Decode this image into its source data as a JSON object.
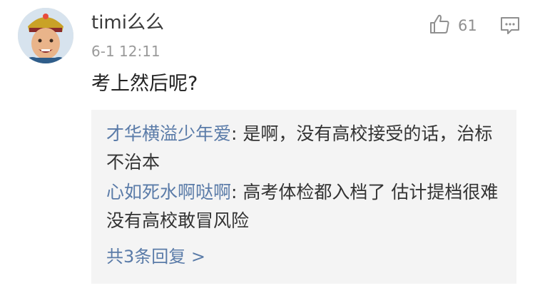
{
  "comment": {
    "username": "timi么么",
    "timestamp": "6-1 12:11",
    "text": "考上然后呢?",
    "like_count": "61",
    "icons": {
      "avatar": "avatar-photo",
      "like": "thumbs-up-icon",
      "reply": "comment-bubble-icon"
    }
  },
  "replies": [
    {
      "author": "才华横溢少年爱",
      "separator": ": ",
      "text": "是啊，没有高校接受的话，治标不治本"
    },
    {
      "author": "心如死水啊哒啊",
      "separator": ": ",
      "text": "高考体检都入档了 估计提档很难 没有高校敢冒风险"
    }
  ],
  "view_more": "共3条回复 >",
  "colors": {
    "link_blue": "#5a7ba8",
    "reply_bg": "#f4f4f4",
    "meta_gray": "#9a9a9a"
  }
}
